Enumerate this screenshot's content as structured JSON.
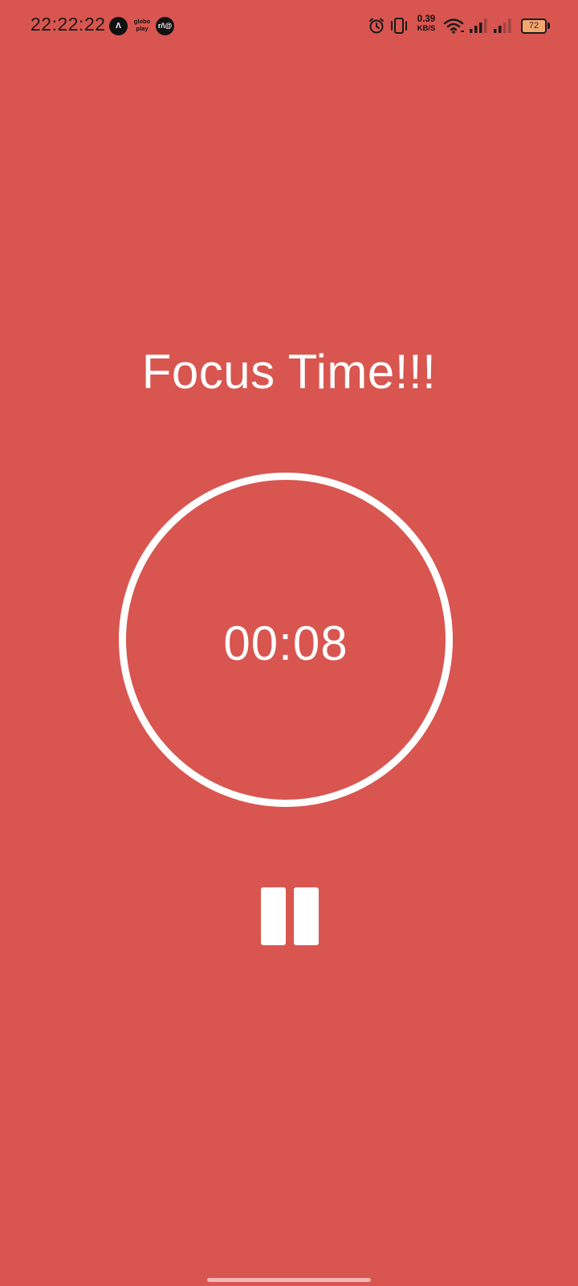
{
  "colors": {
    "background": "#d9554f",
    "foreground": "#ffffff",
    "status_text": "#1a1a1a",
    "battery_fill": "#f3a76f"
  },
  "status_bar": {
    "time": "22:22:22",
    "notification_icons": [
      {
        "name": "a-app-icon",
        "glyph": "Λ"
      },
      {
        "name": "globoplay-icon",
        "line1": "globo",
        "line2": "play"
      },
      {
        "name": "rwa-app-icon",
        "glyph": "r/\\@"
      }
    ],
    "net_speed_value": "0.39",
    "net_speed_unit": "KB/S",
    "battery_level": "72",
    "system_icons": [
      "alarm-icon",
      "vibrate-icon",
      "wifi-icon",
      "signal-icon-sim1",
      "signal-icon-sim2"
    ]
  },
  "main": {
    "title": "Focus Time!!!",
    "timer": "00:08",
    "control": "pause-icon"
  }
}
